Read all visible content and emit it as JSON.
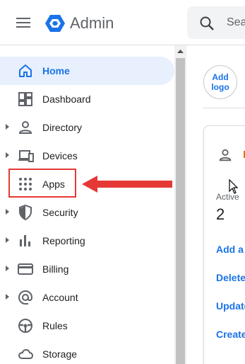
{
  "header": {
    "app_title": "Admin",
    "search_text": "Sea",
    "menu_icon": "hamburger-menu-icon",
    "logo_icon": "admin-hexagon-logo",
    "logo_color": "#1a73e8"
  },
  "sidebar": {
    "items": [
      {
        "label": "Home",
        "icon": "home-icon",
        "expandable": false,
        "active": true
      },
      {
        "label": "Dashboard",
        "icon": "dashboard-icon",
        "expandable": false,
        "active": false
      },
      {
        "label": "Directory",
        "icon": "person-icon",
        "expandable": true,
        "active": false
      },
      {
        "label": "Devices",
        "icon": "devices-icon",
        "expandable": true,
        "active": false
      },
      {
        "label": "Apps",
        "icon": "apps-grid-icon",
        "expandable": false,
        "active": false
      },
      {
        "label": "Security",
        "icon": "shield-icon",
        "expandable": true,
        "active": false
      },
      {
        "label": "Reporting",
        "icon": "bar-chart-icon",
        "expandable": true,
        "active": false
      },
      {
        "label": "Billing",
        "icon": "credit-card-icon",
        "expandable": true,
        "active": false
      },
      {
        "label": "Account",
        "icon": "at-sign-icon",
        "expandable": true,
        "active": false
      },
      {
        "label": "Rules",
        "icon": "steering-wheel-icon",
        "expandable": false,
        "active": false
      },
      {
        "label": "Storage",
        "icon": "cloud-icon",
        "expandable": false,
        "active": false
      }
    ]
  },
  "annotation": {
    "highlight_color": "#e53935",
    "target": "Apps"
  },
  "main": {
    "logo_button_label": "Add logo",
    "card": {
      "active_label": "Active",
      "active_count": "2",
      "links": [
        "Add a",
        "Delete",
        "Update",
        "Create"
      ]
    }
  },
  "colors": {
    "accent": "#1a73e8",
    "active_bg": "#e8f0fe",
    "text": "#202124",
    "muted": "#5f6368"
  }
}
